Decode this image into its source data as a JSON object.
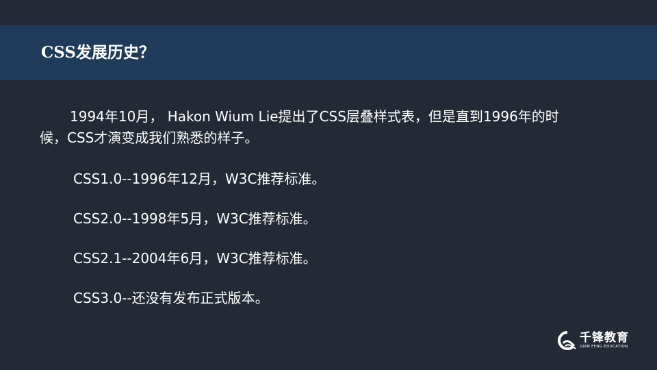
{
  "title": "CSS发展历史？",
  "intro": "1994年10月， Hakon Wium Lie提出了CSS层叠样式表，但是直到1996年的时候，CSS才演变成我们熟悉的样子。",
  "milestones": [
    "CSS1.0--1996年12月，W3C推荐标准。",
    "CSS2.0--1998年5月，W3C推荐标准。",
    "CSS2.1--2004年6月，W3C推荐标准。",
    "CSS3.0--还没有发布正式版本。"
  ],
  "logo": {
    "name_cn": "千锋教育",
    "name_en": "QIAN FENG EDUCATION"
  },
  "colors": {
    "background": "#232a35",
    "title_band": "#203a5a",
    "text": "#ffffff"
  }
}
